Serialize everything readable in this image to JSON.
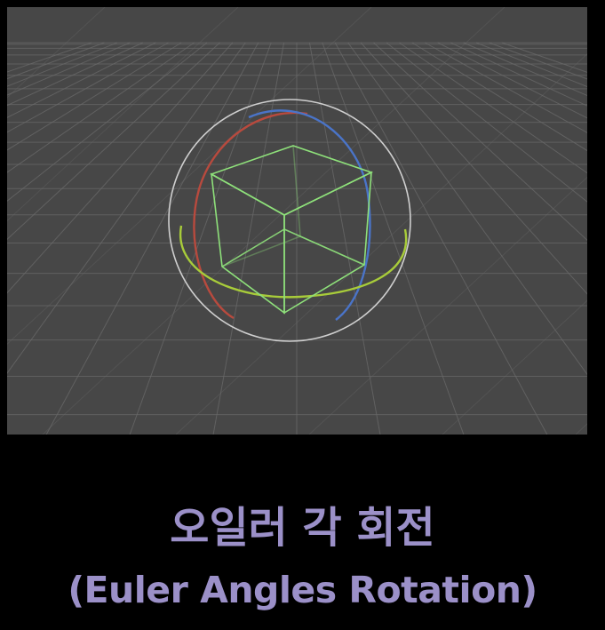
{
  "scene": {
    "background_color": "#474747",
    "grid_color": "#6a6a6a",
    "gizmo": {
      "sphere_color": "#cfcfcf",
      "x_ring_color": "#b84a3e",
      "y_ring_color": "#a8cc3a",
      "z_ring_color": "#4a74c8",
      "cube_color": "#8ee07a"
    }
  },
  "caption": {
    "korean": "오일러 각 회전",
    "english": "(Euler Angles Rotation)",
    "color": "#9b90c8"
  }
}
